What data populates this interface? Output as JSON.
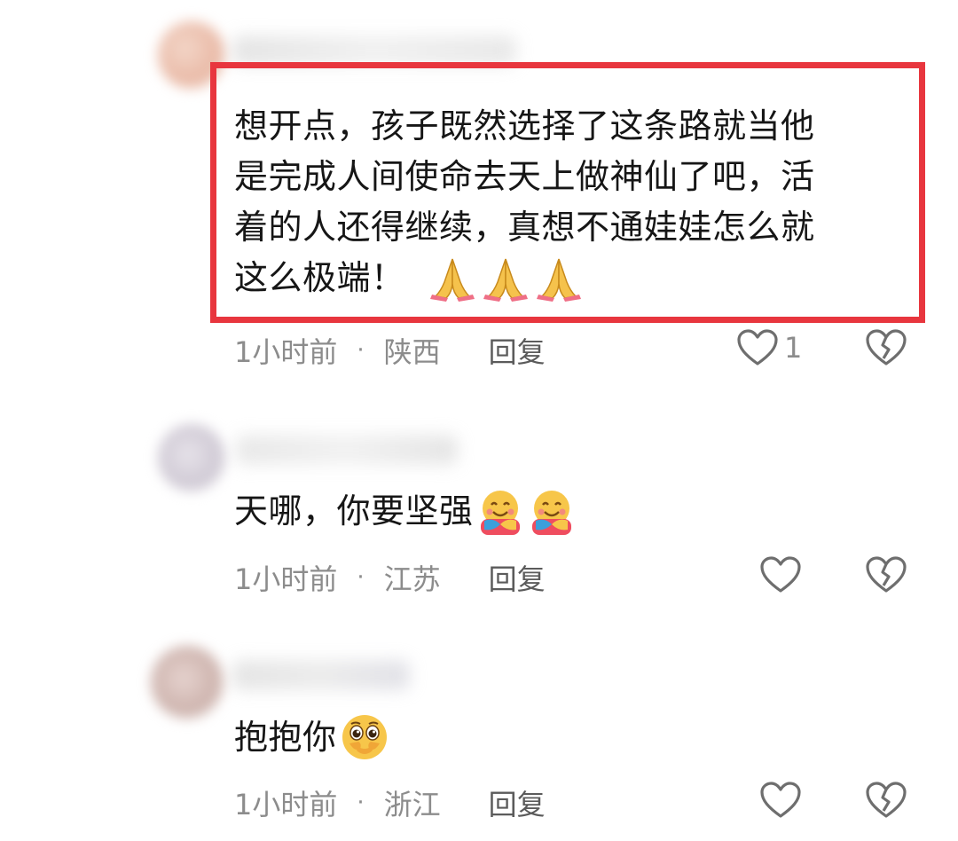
{
  "comments": [
    {
      "text_lines": [
        "想开点，孩子既然选择了这条路就当他",
        "是完成人间使命去天上做神仙了吧，活",
        "着的人还得继续，真想不通娃娃怎么就",
        "这么极端！"
      ],
      "emojis": [
        "folded-hands",
        "folded-hands",
        "folded-hands"
      ],
      "time": "1小时前",
      "dot": "·",
      "location": "陕西",
      "reply_label": "回复",
      "like_count": "1",
      "highlighted": true,
      "highlight_color": "#e8363e"
    },
    {
      "text": "天哪，你要坚强",
      "emojis": [
        "hugging-face",
        "hugging-face"
      ],
      "time": "1小时前",
      "dot": "·",
      "location": "江苏",
      "reply_label": "回复"
    },
    {
      "text": "抱抱你",
      "emojis": [
        "pleading-face"
      ],
      "time": "1小时前",
      "dot": "·",
      "location": "浙江",
      "reply_label": "回复"
    }
  ],
  "colors": {
    "meta_text": "#8c8c8c",
    "reply_text": "#5b5b5b",
    "body_text": "#161616",
    "icon_stroke": "#6e6e6e"
  }
}
